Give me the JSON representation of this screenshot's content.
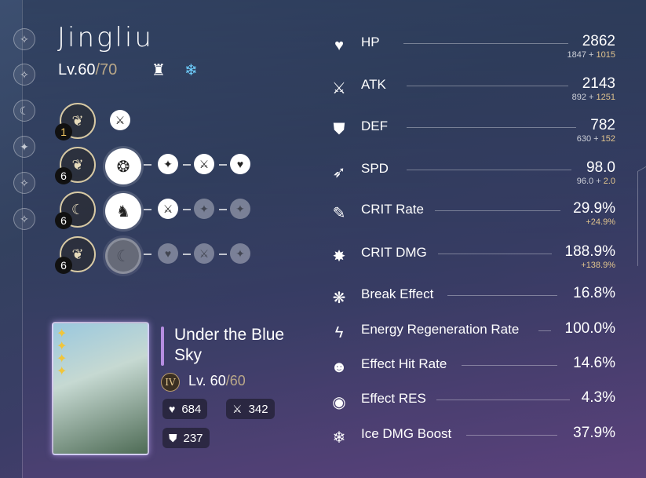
{
  "character": {
    "name": "Jingliu",
    "level_current": "Lv.60",
    "level_max": "/70",
    "path_icon": "destruction-path-icon",
    "element_icon": "ice-element-icon"
  },
  "sidebar": {
    "icons": [
      "eidolon-icon-1",
      "eidolon-icon-2",
      "eidolon-icon-3",
      "eidolon-icon-4",
      "eidolon-icon-5",
      "eidolon-icon-6"
    ]
  },
  "traces": [
    {
      "eidolon": "1",
      "eidolon_gold": true
    },
    {
      "eidolon": "6",
      "eidolon_gold": false
    },
    {
      "eidolon": "6",
      "eidolon_gold": false
    },
    {
      "eidolon": "6",
      "eidolon_gold": false
    }
  ],
  "light_cone": {
    "title": "Under the Blue Sky",
    "superimposition": "IV",
    "level_current": "Lv. 60",
    "level_max": "/60",
    "stats": {
      "hp": "684",
      "atk": "342",
      "def": "237"
    }
  },
  "stats": [
    {
      "name": "HP",
      "icon": "hp-icon",
      "value": "2862",
      "base": "1847",
      "bonus": "1015"
    },
    {
      "name": "ATK",
      "icon": "atk-icon",
      "value": "2143",
      "base": "892",
      "bonus": "1251"
    },
    {
      "name": "DEF",
      "icon": "def-icon",
      "value": "782",
      "base": "630",
      "bonus": "152"
    },
    {
      "name": "SPD",
      "icon": "spd-icon",
      "value": "98.0",
      "base": "96.0",
      "bonus": "2.0"
    },
    {
      "name": "CRIT Rate",
      "icon": "crit-rate-icon",
      "value": "29.9%",
      "base": "",
      "bonus": "+24.9%"
    },
    {
      "name": "CRIT DMG",
      "icon": "crit-dmg-icon",
      "value": "188.9%",
      "base": "",
      "bonus": "+138.9%"
    },
    {
      "name": "Break Effect",
      "icon": "break-effect-icon",
      "value": "16.8%"
    },
    {
      "name": "Energy Regeneration Rate",
      "icon": "energy-regen-icon",
      "value": "100.0%"
    },
    {
      "name": "Effect Hit Rate",
      "icon": "effect-hit-rate-icon",
      "value": "14.6%"
    },
    {
      "name": "Effect RES",
      "icon": "effect-res-icon",
      "value": "4.3%"
    },
    {
      "name": "Ice DMG Boost",
      "icon": "ice-dmg-boost-icon",
      "value": "37.9%"
    }
  ],
  "colors": {
    "accent_gold": "#b9a788",
    "bonus": "#e1c48e",
    "ice": "#6fd0ff",
    "lc_bar": "#b58de0"
  }
}
